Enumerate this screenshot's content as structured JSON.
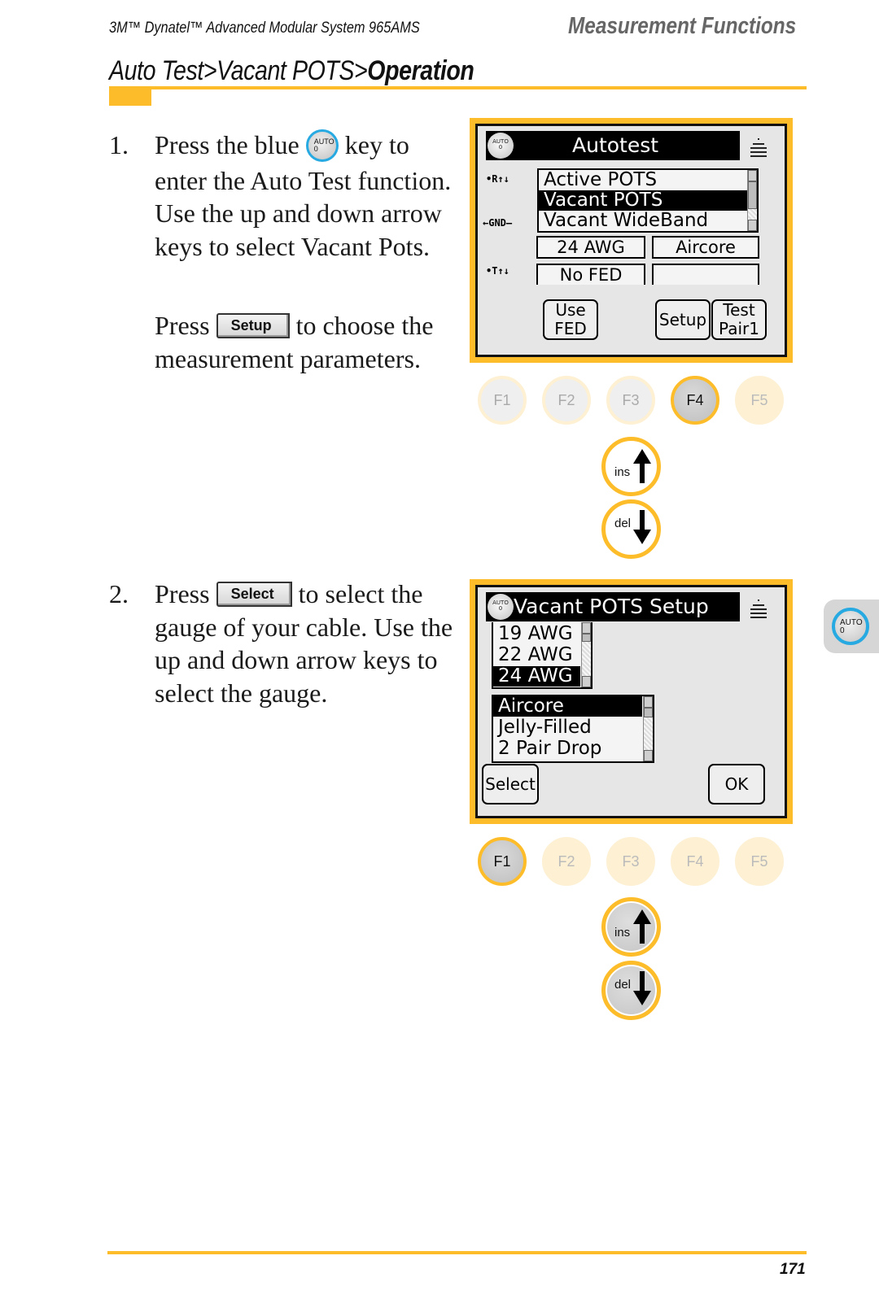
{
  "header": {
    "product": "3M™ Dynatel™ Advanced Modular System 965AMS",
    "section": "Measurement Functions"
  },
  "breadcrumb": {
    "part1": "Auto Test>Vacant POTS>",
    "part2": "Operation"
  },
  "colors": {
    "accent": "#fdbd2a",
    "auto_key_ring": "#27a9e1"
  },
  "steps": [
    {
      "number": "1.",
      "text_before_key": "Press the blue ",
      "key_label_line1": "AUTO",
      "key_label_line2": "0",
      "text_after_key": " key to enter the Auto Test function. Use the up and down arrow keys to select Vacant Pots.",
      "sub_before": "Press ",
      "sub_button": "Setup",
      "sub_after": " to choose the measurement parameters."
    },
    {
      "number": "2.",
      "text_before": "Press ",
      "button": "Select",
      "text_after": " to select the gauge of your cable. Use the up and down arrow keys to select the gauge."
    }
  ],
  "screen1": {
    "logo_line1": "AUTO",
    "logo_line2": "0",
    "title": "Autotest",
    "side_icons": [
      "ring-tip-icon",
      "ground-icon",
      "tip-icon"
    ],
    "side_labels": [
      "•R↑↓",
      "←GND—",
      "•T↑↓"
    ],
    "test_list": [
      "Active POTS",
      "Vacant POTS",
      "Vacant WideBand"
    ],
    "selected_index": 1,
    "gauge": "24 AWG",
    "cable_type": "Aircore",
    "fed": "No FED",
    "empty_field": "",
    "buttons": {
      "use_fed": [
        "Use",
        "FED"
      ],
      "setup": "Setup",
      "test_pair": [
        "Test",
        "Pair1"
      ]
    },
    "fkeys": [
      "F1",
      "F2",
      "F3",
      "F4",
      "F5"
    ],
    "active_fkey": "F4",
    "ins_label": "ins",
    "del_label": "del"
  },
  "screen2": {
    "logo_line1": "AUTO",
    "logo_line2": "0",
    "title": "Vacant POTS Setup",
    "gauges": [
      "19 AWG",
      "22 AWG",
      "24 AWG"
    ],
    "selected_gauge_index": 2,
    "cable_types": [
      "Aircore",
      "Jelly-Filled",
      "2 Pair Drop"
    ],
    "selected_cable_index": 0,
    "buttons": {
      "select": "Select",
      "ok": "OK"
    },
    "fkeys": [
      "F1",
      "F2",
      "F3",
      "F4",
      "F5"
    ],
    "active_fkey": "F1",
    "ins_label": "ins",
    "del_label": "del"
  },
  "side_tab": {
    "line1": "AUTO",
    "line2": "0"
  },
  "footer": {
    "page_number": "171"
  }
}
